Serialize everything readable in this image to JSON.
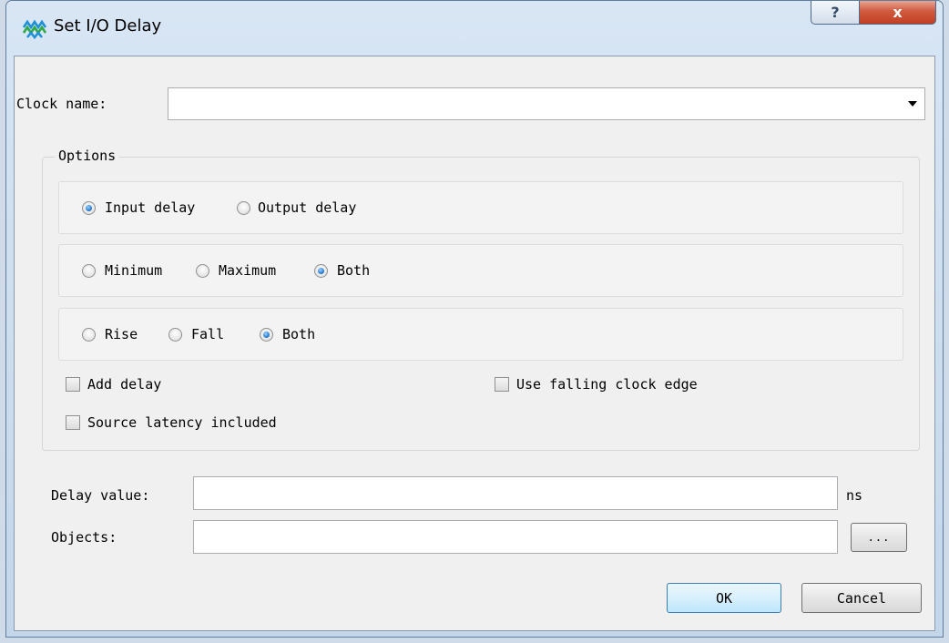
{
  "window": {
    "title": "Set I/O Delay",
    "help_label": "?",
    "close_label": "x"
  },
  "clock": {
    "label": "Clock name:",
    "value": ""
  },
  "options": {
    "title": "Options",
    "direction": [
      "Input delay",
      "Output delay"
    ],
    "direction_selected": "Input delay",
    "minmax": [
      "Minimum",
      "Maximum",
      "Both"
    ],
    "minmax_selected": "Both",
    "edge": [
      "Rise",
      "Fall",
      "Both"
    ],
    "edge_selected": "Both",
    "add_delay": "Add delay",
    "add_delay_checked": false,
    "use_falling_clock_edge": "Use falling clock edge",
    "use_falling_clock_edge_checked": false,
    "source_latency_included": "Source latency included",
    "source_latency_included_checked": false
  },
  "delay": {
    "label": "Delay value:",
    "value": "",
    "unit": "ns"
  },
  "objects": {
    "label": "Objects:",
    "value": "",
    "browse_label": "..."
  },
  "buttons": {
    "ok": "OK",
    "cancel": "Cancel"
  },
  "colors": {
    "accent": "#2a7fd0",
    "close_red": "#c23f24"
  }
}
